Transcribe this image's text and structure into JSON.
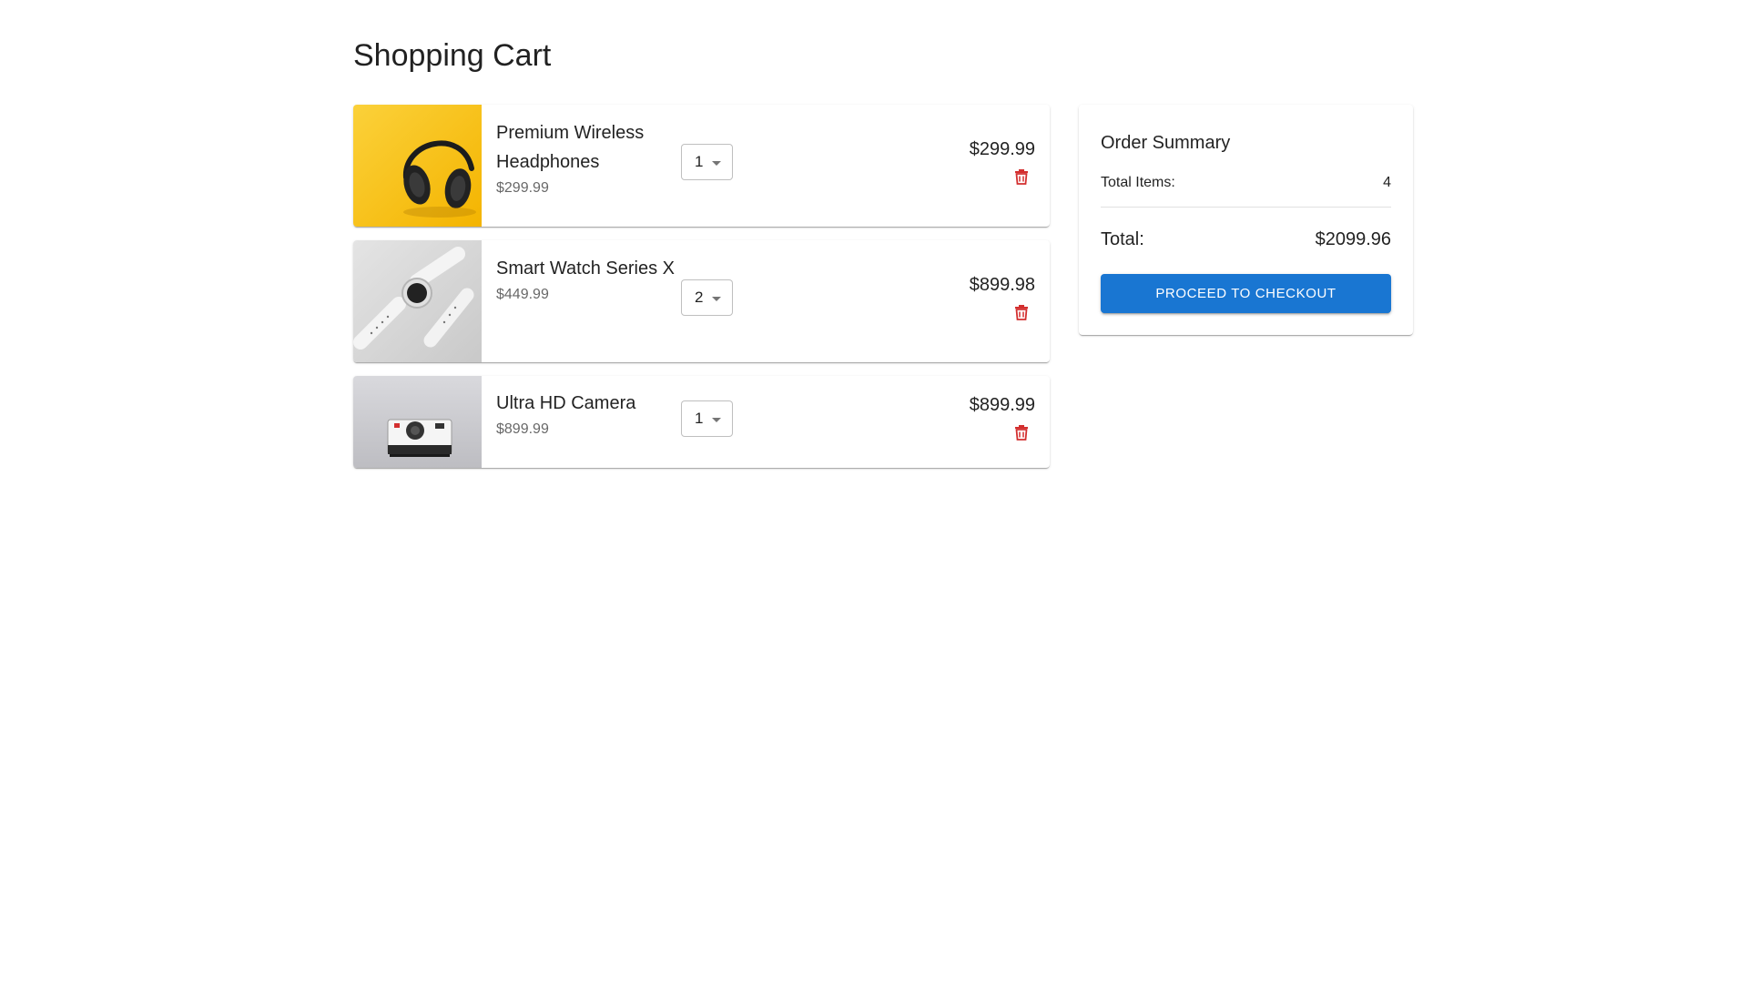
{
  "page": {
    "title": "Shopping Cart"
  },
  "cart": {
    "items": [
      {
        "name": "Premium Wireless Headphones",
        "unit_price": "$299.99",
        "quantity": "1",
        "line_total": "$299.99",
        "image": "headphones-photo"
      },
      {
        "name": "Smart Watch Series X",
        "unit_price": "$449.99",
        "quantity": "2",
        "line_total": "$899.98",
        "image": "smartwatch-photo"
      },
      {
        "name": "Ultra HD Camera",
        "unit_price": "$899.99",
        "quantity": "1",
        "line_total": "$899.99",
        "image": "camera-photo"
      }
    ]
  },
  "summary": {
    "title": "Order Summary",
    "items_label": "Total Items:",
    "items_value": "4",
    "total_label": "Total:",
    "total_value": "$2099.96",
    "checkout_label": "Proceed to Checkout"
  },
  "colors": {
    "primary": "#1976d2",
    "delete": "#d32f2f",
    "headphones_bg": "#f5c518"
  },
  "icons": {
    "delete": "trash-icon",
    "quantity_dropdown": "caret-down-icon"
  }
}
